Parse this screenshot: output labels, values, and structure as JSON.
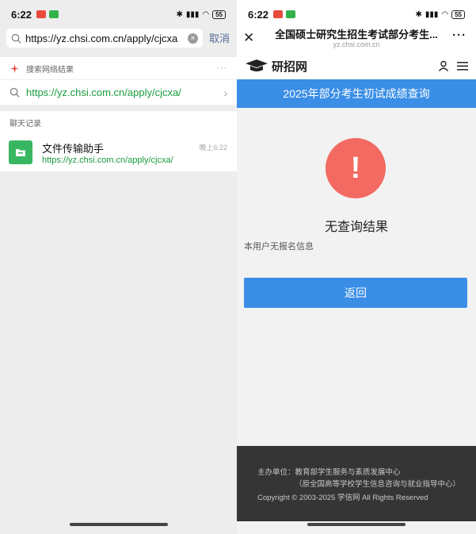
{
  "left": {
    "status": {
      "time": "6:22",
      "battery": "55"
    },
    "search": {
      "value": "https://yz.chsi.com.cn/apply/cjcxa",
      "cancel_label": "取消"
    },
    "web_results": {
      "header": "搜索网络结果",
      "url": "https://yz.chsi.com.cn/apply/cjcxa/"
    },
    "chat_records": {
      "header": "聊天记录",
      "item": {
        "name": "文件传输助手",
        "link": "https://yz.chsi.com.cn/apply/cjcxa/",
        "time": "晚上6:22"
      }
    }
  },
  "right": {
    "status": {
      "time": "6:22",
      "battery": "55"
    },
    "topbar": {
      "title": "全国硕士研究生招生考试部分考生...",
      "domain": "yz.chsi.com.cn"
    },
    "site": {
      "logo_text": "研招网"
    },
    "banner": "2025年部分考生初试成绩查询",
    "result": {
      "mark": "!",
      "title": "无查询结果",
      "reason": "本用户无报名信息",
      "back_label": "返回"
    },
    "footer": {
      "line1": "主办单位：教育部学生服务与素质发展中心",
      "line2": "（原全国高等学校学生信息咨询与就业指导中心）",
      "line3": "Copyright © 2003-2025 学信网 All Rights Reserved"
    }
  },
  "colors": {
    "accent_blue": "#3a8ee6",
    "link_green": "#1a9c3e",
    "alert_red": "#f26a62",
    "footer_bg": "#353535"
  }
}
